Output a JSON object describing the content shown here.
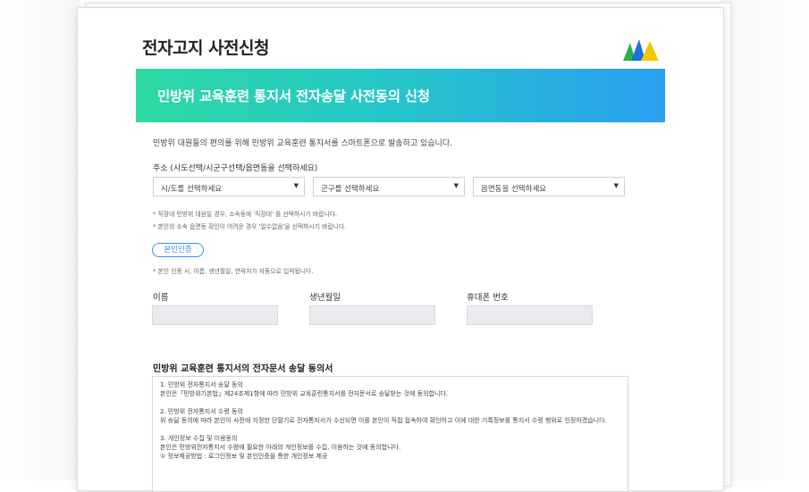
{
  "page": {
    "title": "전자고지 사전신청"
  },
  "banner": {
    "title": "민방위 교육훈련 통지서 전자송달 사전동의 신청"
  },
  "intro": "민방위 대원들의 편의를 위해 민방위 교육훈련 통지서를 스마트폰으로 발송하고 있습니다.",
  "address": {
    "label": "주소 (시도선택/시군구선택/읍면동을 선택하세요)",
    "selects": [
      {
        "value": "시/도를 선택하세요"
      },
      {
        "value": "군구를 선택하세요"
      },
      {
        "value": "읍면동을 선택하세요"
      }
    ],
    "notes": [
      "* 직장대 민방위 대원일 경우, 소속동에 '직장대' 를 선택하시기 바랍니다.",
      "* 본인의 소속 읍면동 확인이 어려운 경우 '알수없음'을 선택하시기 바랍니다."
    ]
  },
  "auth": {
    "button_label": "본인인증",
    "note": "* 본인 인증 시, 이름, 생년월일, 연락처가 자동으로 입력됩니다."
  },
  "fields": [
    {
      "label": "이름"
    },
    {
      "label": "생년월일"
    },
    {
      "label": "휴대폰 번호"
    }
  ],
  "consent": {
    "title": "민방위 교육훈련 통지서의 전자문서 송달 동의서",
    "text": "1. 민방위 전자통지서 송달 동의\n본인은「민방위기본법」제24조제1항에 따라 민방위 교육훈련통지서를 전자문서로 송달받는 것에 동의합니다.\n\n2. 민방위 전자통지서 수령 동의\n위 송달 동의에 따라 본인이 사전에 지정한 단말기로 전자통지서가 수신되면 이를 본인이 직접 접속하여 확인하고 이에 대한 기록정보를 통지서 수령 행위로 인정하겠습니다.\n\n3. 개인정보 수집 및 이용동의\n본인은 민방위전자통지서 수령에 필요한 아래의 개인정보를 수집, 이용하는 것에 동의합니다.\n① 정보제공방법 : 로그인정보 및 본인인증을 통한 개인정보 제공"
  },
  "colors": {
    "banner_start": "#2dd9a3",
    "banner_end": "#2a9ff2",
    "accent": "#3a8ff0"
  }
}
